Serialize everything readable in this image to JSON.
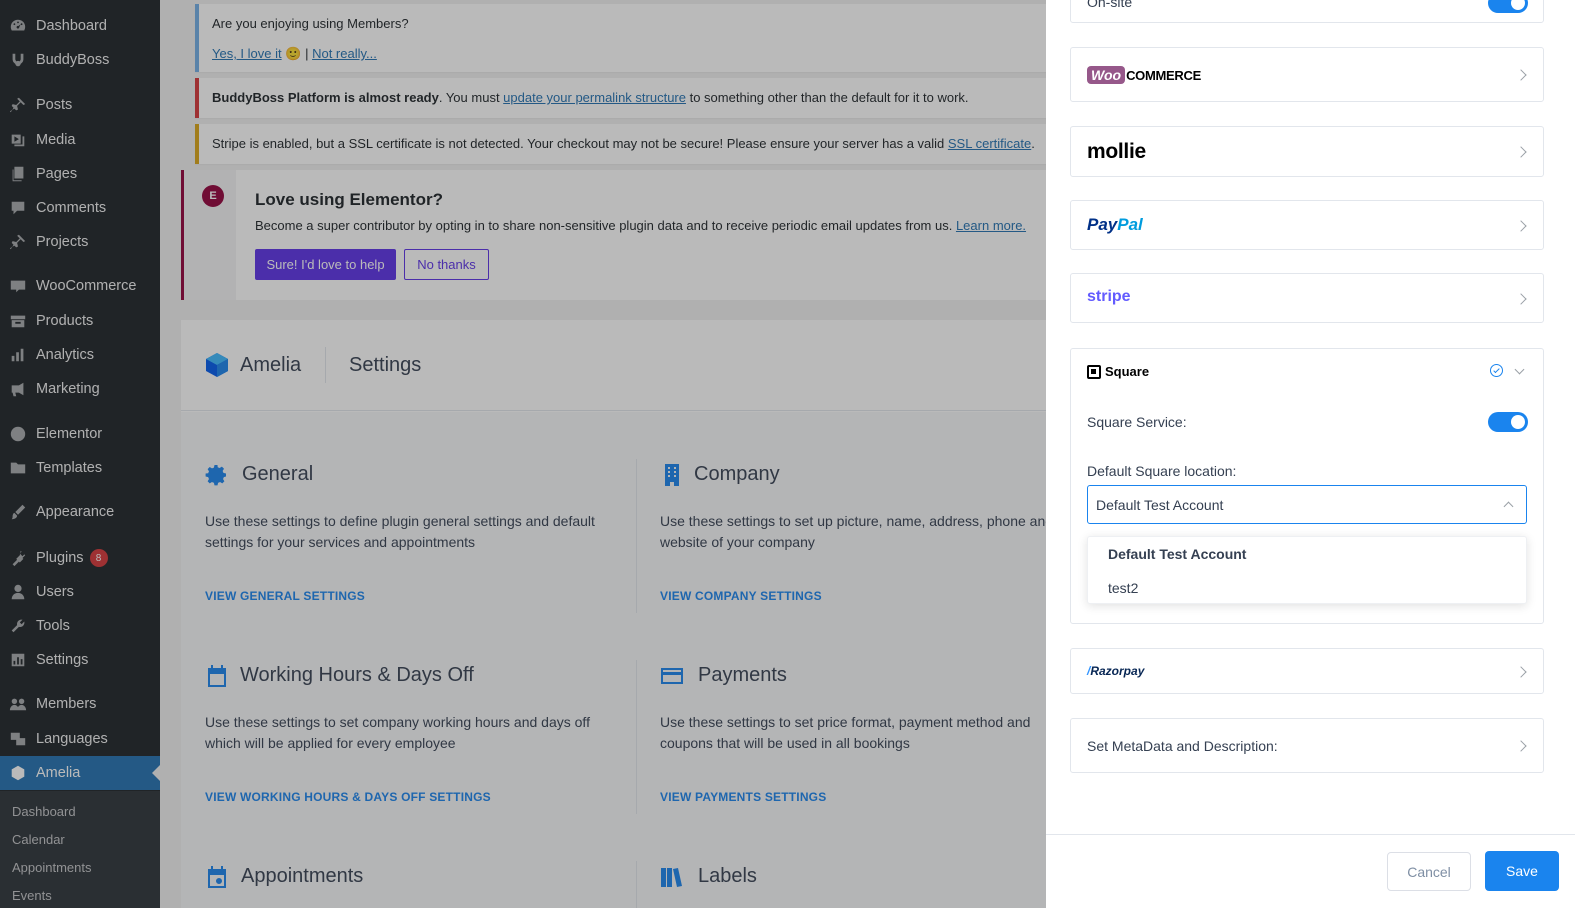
{
  "sidebar": {
    "items": [
      {
        "label": "Dashboard",
        "icon": "dashboard-icon"
      },
      {
        "label": "BuddyBoss",
        "icon": "buddyboss-icon"
      },
      {
        "label": "Posts",
        "icon": "pin-icon"
      },
      {
        "label": "Media",
        "icon": "media-icon"
      },
      {
        "label": "Pages",
        "icon": "pages-icon"
      },
      {
        "label": "Comments",
        "icon": "comments-icon"
      },
      {
        "label": "Projects",
        "icon": "pin-icon"
      },
      {
        "label": "WooCommerce",
        "icon": "woo-icon"
      },
      {
        "label": "Products",
        "icon": "products-icon"
      },
      {
        "label": "Analytics",
        "icon": "analytics-icon"
      },
      {
        "label": "Marketing",
        "icon": "megaphone-icon"
      },
      {
        "label": "Elementor",
        "icon": "elementor-icon"
      },
      {
        "label": "Templates",
        "icon": "folder-icon"
      },
      {
        "label": "Appearance",
        "icon": "brush-icon"
      },
      {
        "label": "Plugins",
        "icon": "plugin-icon",
        "badge": "8"
      },
      {
        "label": "Users",
        "icon": "user-icon"
      },
      {
        "label": "Tools",
        "icon": "wrench-icon"
      },
      {
        "label": "Settings",
        "icon": "settings-icon"
      },
      {
        "label": "Members",
        "icon": "members-icon"
      },
      {
        "label": "Languages",
        "icon": "languages-icon"
      },
      {
        "label": "Amelia",
        "icon": "amelia-icon"
      }
    ],
    "submenu": [
      "Dashboard",
      "Calendar",
      "Appointments",
      "Events"
    ]
  },
  "notices": {
    "members": {
      "question": "Are you enjoying using Members?",
      "yes": "Yes, I love it",
      "emoji": "🙂",
      "sep": "|",
      "no": "Not really..."
    },
    "buddyboss": {
      "bold": "BuddyBoss Platform is almost ready",
      "text1": ". You must ",
      "link": "update your permalink structure",
      "text2": " to something other than the default for it to work."
    },
    "stripe": {
      "text": "Stripe is enabled, but a SSL certificate is not detected. Your checkout may not be secure! Please ensure your server has a valid ",
      "link": "SSL certificate",
      "end": "."
    },
    "elementor": {
      "title": "Love using Elementor?",
      "text": "Become a super contributor by opting in to share non-sensitive plugin data and to receive periodic email updates from us. ",
      "link": "Learn more.",
      "primary": "Sure! I'd love to help",
      "secondary": "No thanks"
    }
  },
  "amelia": {
    "brand": "Amelia",
    "page_title": "Settings",
    "cards": [
      {
        "title": "General",
        "desc": "Use these settings to define plugin general settings and default settings for your services and appointments",
        "link": "VIEW GENERAL SETTINGS"
      },
      {
        "title": "Company",
        "desc": "Use these settings to set up picture, name, address, phone and website of your company",
        "link": "VIEW COMPANY SETTINGS"
      },
      {
        "title": "Working Hours & Days Off",
        "desc": "Use these settings to set company working hours and days off which will be applied for every employee",
        "link": "VIEW WORKING HOURS & DAYS OFF SETTINGS"
      },
      {
        "title": "Payments",
        "desc": "Use these settings to set price format, payment method and coupons that will be used in all bookings",
        "link": "VIEW PAYMENTS SETTINGS"
      },
      {
        "title": "Appointments"
      },
      {
        "title": "Labels"
      }
    ]
  },
  "drawer": {
    "onsite_label": "On-site",
    "gateways": {
      "woo": {
        "part1": "Woo",
        "part2": "COMMERCE"
      },
      "mollie": "mollie",
      "paypal": {
        "part1": "Pay",
        "part2": "Pal"
      },
      "stripe": "stripe",
      "square": "Square",
      "razorpay": "Razorpay"
    },
    "square": {
      "service_label": "Square Service:",
      "location_label": "Default Square location:",
      "selected": "Default Test Account",
      "options": [
        "Default Test Account",
        "test2"
      ]
    },
    "metadata_label": "Set MetaData and Description:",
    "cancel": "Cancel",
    "save": "Save"
  },
  "colors": {
    "wp_blue": "#2271b1",
    "amelia_blue": "#1a84ee",
    "elementor": "#92003b",
    "woo": "#96588a",
    "paypal_dark": "#003087",
    "paypal_light": "#009cde",
    "stripe": "#635bff"
  }
}
